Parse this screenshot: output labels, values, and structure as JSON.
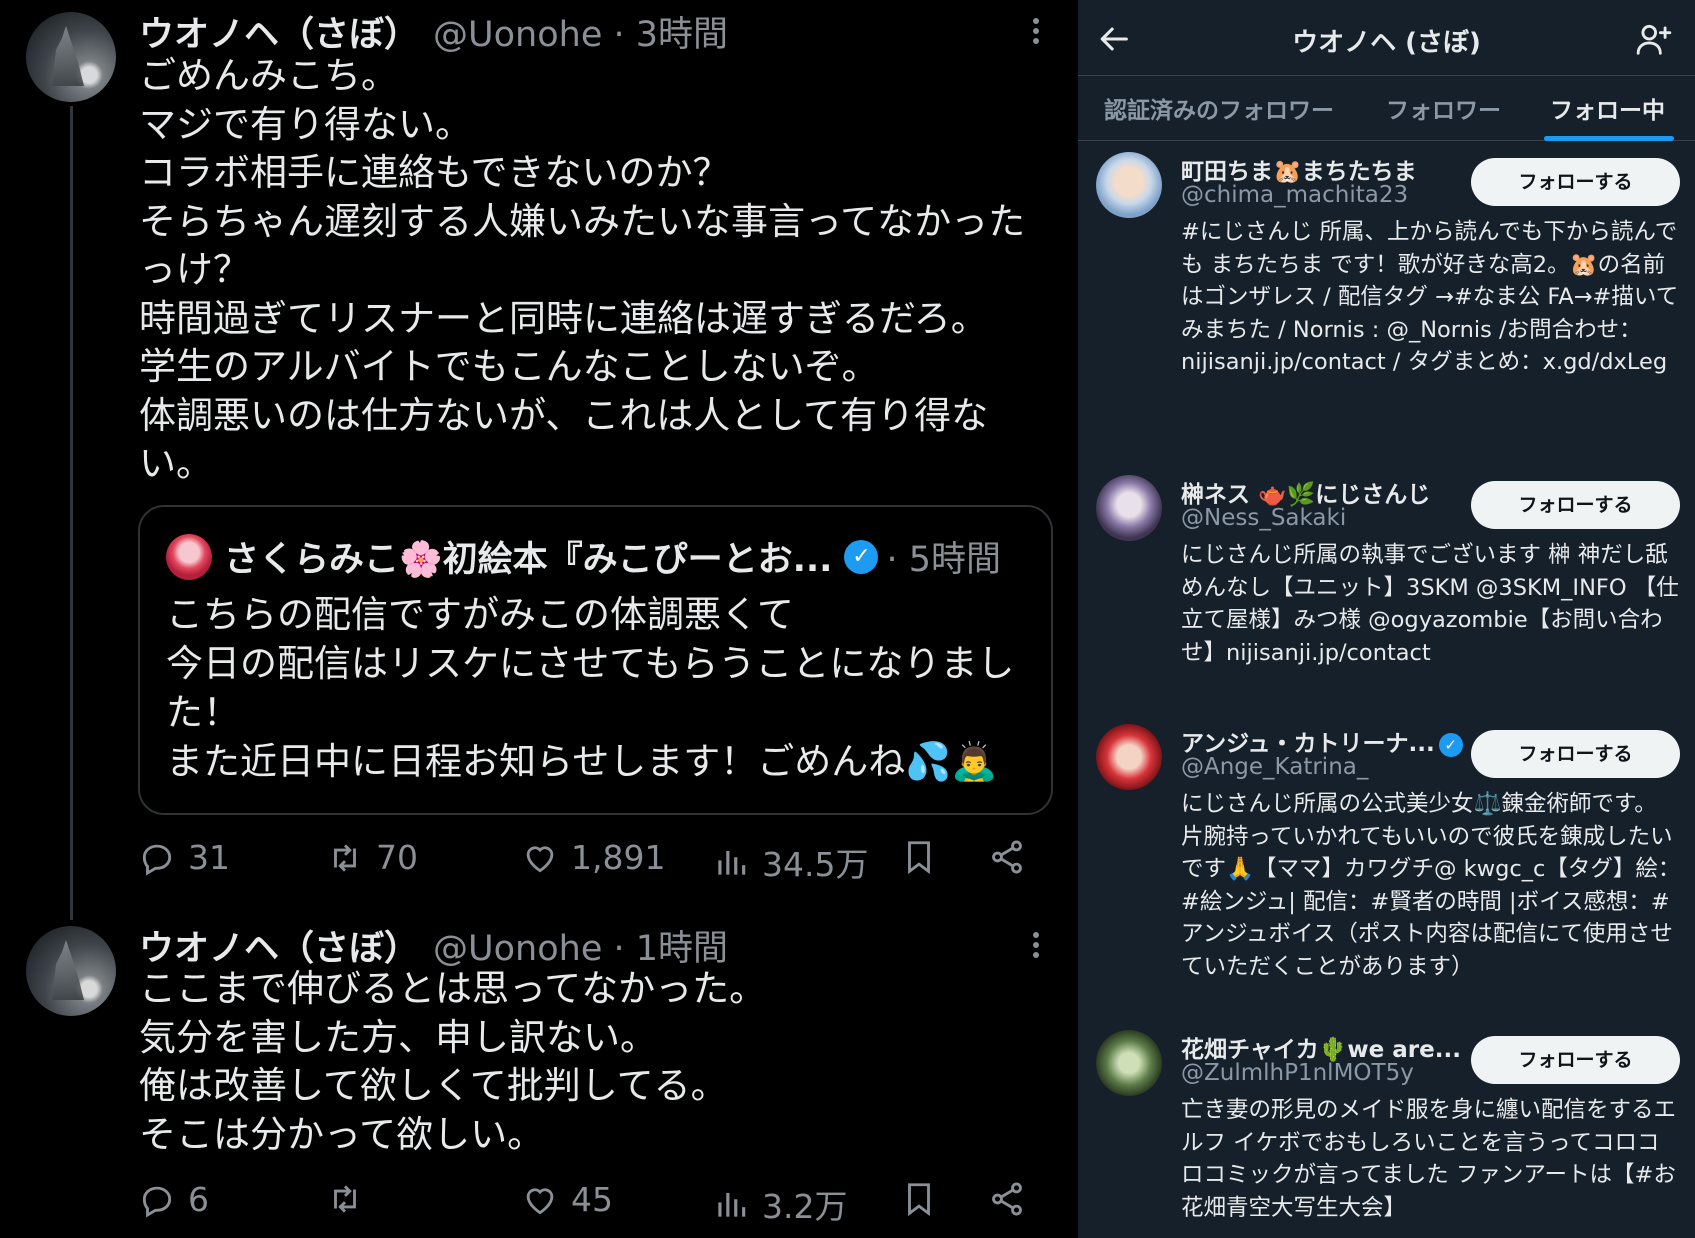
{
  "tweets": [
    {
      "name": "ウオノヘ（さぼ）",
      "meta": "@Uonohe · 3時間",
      "body": "ごめんみこち。\nマジで有り得ない。\nコラボ相手に連絡もできないのか？\nそらちゃん遅刻する人嫌いみたいな事言ってなかった\nっけ？\n時間過ぎてリスナーと同時に連絡は遅すぎるだろ。\n学生のアルバイトでもこんなことしないぞ。\n体調悪いのは仕方ないが、これは人として有り得な\nい。",
      "quote": {
        "name": "さくらみこ🌸初絵本『みこぴーとお...",
        "verified": "✓",
        "time": "· 5時間",
        "body": "こちらの配信ですがみこの体調悪くて\n今日の配信はリスケにさせてもらうことになりまし\nた！\nまた近日中に日程お知らせします！ごめんね💦🙇‍♂️"
      },
      "replies": "31",
      "retweets": "70",
      "likes": "1,891",
      "views": "34.5万"
    },
    {
      "name": "ウオノヘ（さぼ）",
      "meta": "@Uonohe · 1時間",
      "body": "ここまで伸びるとは思ってなかった。\n気分を害した方、申し訳ない。\n俺は改善して欲しくて批判してる。\nそこは分かって欲しい。",
      "replies": "6",
      "retweets": "",
      "likes": "45",
      "views": "3.2万"
    }
  ],
  "panel": {
    "title": "ウオノヘ (さぼ)",
    "tabs": [
      "認証済みのフォロワー",
      "フォロワー",
      "フォロー中"
    ],
    "active_tab": "フォロー中",
    "follow_label": "フォローする",
    "users": [
      {
        "name": "町田ちま🐹まちたちま",
        "handle": "@chima_machita23",
        "bio": "#にじさんじ 所属、上から読んでも下から読んでも まちたちま です！歌が好きな高2。🐹の名前はゴンザレス / 配信タグ →#なま公 FA→#描いてみまちた / Nornis : @_Nornis /お問合わせ：nijisanji.jp/contact / タグまとめ：x.gd/dxLeg",
        "avatar_color": "#c9d8ea"
      },
      {
        "name": "榊ネス 🫖🌿にじさんじ",
        "handle": "@Ness_Sakaki",
        "bio": "にじさんじ所属の執事でございます 榊 神だし舐めんなし【ユニット】3SKM @3SKM_INFO 【仕立て屋様】みつ様 @ogyazombie【お問い合わせ】nijisanji.jp/contact",
        "avatar_color": "#8a7aa8"
      },
      {
        "name": "アンジュ・カトリーナ...",
        "verified": "✓",
        "handle": "@Ange_Katrina_",
        "bio": "にじさんじ所属の公式美少女⚖️錬金術師です。 片腕持っていかれてもいいので彼氏を錬成したいです🙏【ママ】カワグチ@ kwgc_c【タグ】絵：#絵ンジュ| 配信：#賢者の時間 |ボイス感想：#アンジュボイス（ポスト内容は配信にて使用させていただくことがあります）",
        "avatar_color": "#d8343a"
      },
      {
        "name": "花畑チャイカ🌵we are...",
        "handle": "@ZulmlhP1nlMOT5y",
        "bio": "亡き妻の形見のメイド服を身に纏い配信をするエルフ イケボでおもしろいことを言うってコロコロコミックが言ってました ファンアートは【#お花畑青空大写生大会】",
        "avatar_color": "#5e7d4a"
      }
    ]
  },
  "icons": [
    "kebab-icon",
    "reply-icon",
    "retweet-icon",
    "like-icon",
    "views-icon",
    "bookmark-icon",
    "share-icon",
    "back-arrow-icon",
    "add-user-icon",
    "verified-icon"
  ],
  "colors": {
    "accent": "#1d9bf0",
    "panel_bg": "#15202b",
    "muted": "#8b9096"
  }
}
